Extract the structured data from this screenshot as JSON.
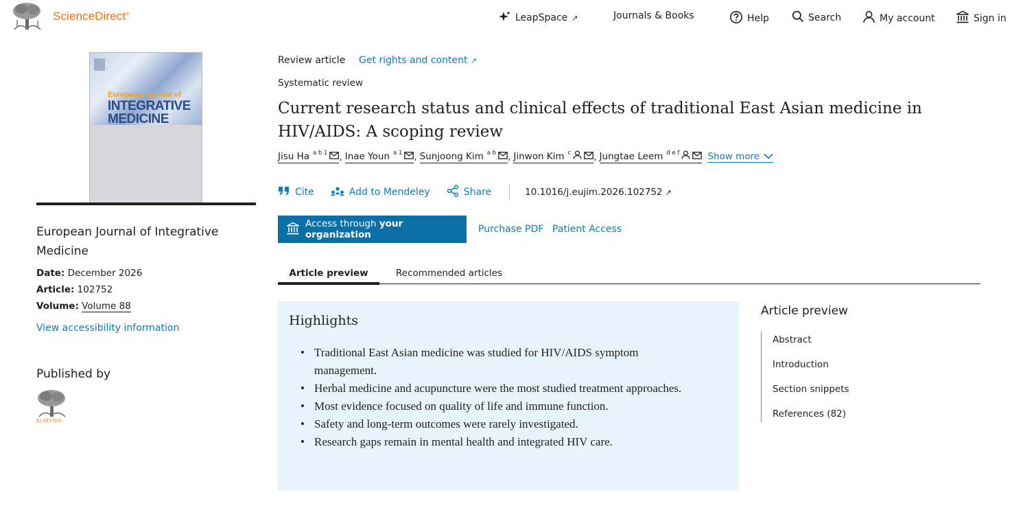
{
  "header": {
    "brand": "ScienceDirect",
    "brand_mark": "®",
    "nav": [
      {
        "label": "LeapSpace",
        "icon": "sparkle-icon",
        "arrow": "↗"
      },
      {
        "label": "Journals & Books"
      },
      {
        "label": "Help",
        "icon": "help-icon"
      },
      {
        "label": "Search",
        "icon": "search-icon"
      },
      {
        "label": "My account",
        "icon": "user-icon"
      },
      {
        "label": "Sign in",
        "icon": "institution-icon"
      }
    ]
  },
  "sidebar": {
    "cover": {
      "line1": "European Journal of",
      "line2": "INTEGRATIVE",
      "line3": "MEDICINE"
    },
    "journal_name": "European Journal of Integrative Medicine",
    "date_label": "Date:",
    "date": "December 2026",
    "article_label": "Article:",
    "article": "102752",
    "volume_label": "Volume:",
    "volume": "Volume 88",
    "accessibility_link": "View accessibility information",
    "published_by": "Published by",
    "publisher_word": "ELSEVIER"
  },
  "article": {
    "type": "Review article",
    "rights_link": "Get rights and content",
    "rights_arrow": "↗",
    "subtype": "Systematic review",
    "title": "Current research status and clinical effects of traditional East Asian medicine in HIV/AIDS: A scoping review",
    "authors": [
      {
        "name": "Jisu Ha",
        "sup": "a b 1",
        "person_icon": false
      },
      {
        "name": "Inae Youn",
        "sup": "a 1",
        "person_icon": false
      },
      {
        "name": "Sunjoong Kim",
        "sup": "a b",
        "person_icon": false
      },
      {
        "name": "Jinwon Kim",
        "sup": "c",
        "person_icon": true
      },
      {
        "name": "Jungtae Leem",
        "sup": "d e f",
        "person_icon": true
      }
    ],
    "author_separator": ",",
    "show_more": "Show more",
    "actions": {
      "cite": "Cite",
      "mendeley": "Add to Mendeley",
      "share": "Share"
    },
    "doi": "10.1016/j.eujim.2026.102752",
    "doi_arrow": "↗",
    "access_button": {
      "prefix": "Access through",
      "bold": "your organization"
    },
    "purchase_pdf": "Purchase PDF",
    "patient_access": "Patient Access"
  },
  "tabs": [
    {
      "label": "Article preview",
      "active": true
    },
    {
      "label": "Recommended articles",
      "active": false
    }
  ],
  "highlights": {
    "title": "Highlights",
    "items": [
      "Traditional East Asian medicine was studied for HIV/AIDS symptom management.",
      "Herbal medicine and acupuncture were the most studied treatment approaches.",
      "Most evidence focused on quality of life and immune function.",
      "Safety and long-term outcomes were rarely investigated.",
      "Research gaps remain in mental health and integrated HIV care."
    ]
  },
  "toc": {
    "title": "Article preview",
    "items": [
      "Abstract",
      "Introduction",
      "Section snippets",
      "References (82)"
    ]
  },
  "colors": {
    "brand": "#e9711c",
    "link": "#0c7dbb",
    "button": "#0c6fa6",
    "highlight_bg": "#e8f4fb"
  }
}
